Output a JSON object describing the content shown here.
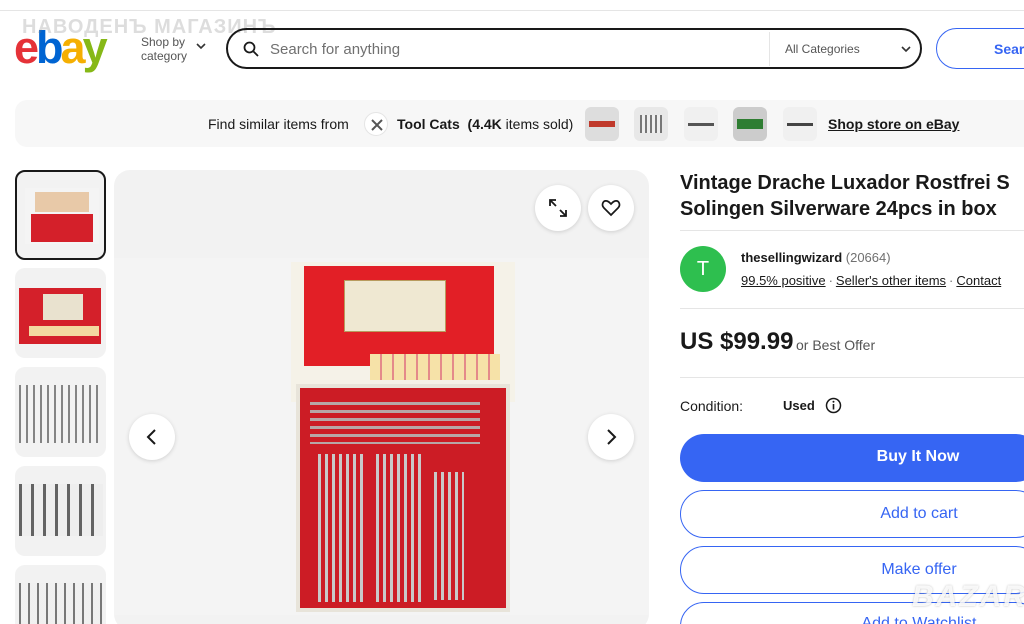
{
  "header": {
    "overlay_text": "НАВОДЕНЪ МАГАЗИНЪ",
    "shop_by_line1": "Shop by",
    "shop_by_line2": "category",
    "search_placeholder": "Search for anything",
    "category_select": "All Categories",
    "search_button": "Sear"
  },
  "similar_bar": {
    "find_text": "Find similar items from",
    "store_name": "Tool Cats",
    "sold_count": "(4.4K",
    "sold_suffix": "items sold)",
    "shop_store_link": "Shop store on eBay"
  },
  "listing": {
    "title_line1": "Vintage Drache Luxador Rostfrei S",
    "title_line2": "Solingen Silverware 24pcs in box",
    "seller": {
      "avatar_letter": "T",
      "name": "thesellingwizard",
      "feedback_count": "(20664)",
      "positive": "99.5% positive",
      "other_items": "Seller's other items",
      "contact": "Contact"
    },
    "price": "US $99.99",
    "best_offer": "or Best Offer",
    "condition_label": "Condition:",
    "condition_value": "Used",
    "buttons": {
      "buy_now": "Buy It Now",
      "add_to_cart": "Add to cart",
      "make_offer": "Make offer",
      "watchlist": "Add to Watchlist"
    }
  },
  "watermark": "BAZAR",
  "colors": {
    "accent": "#3665f3",
    "avatar": "#2ebf4f",
    "box_red": "#d4202a"
  }
}
